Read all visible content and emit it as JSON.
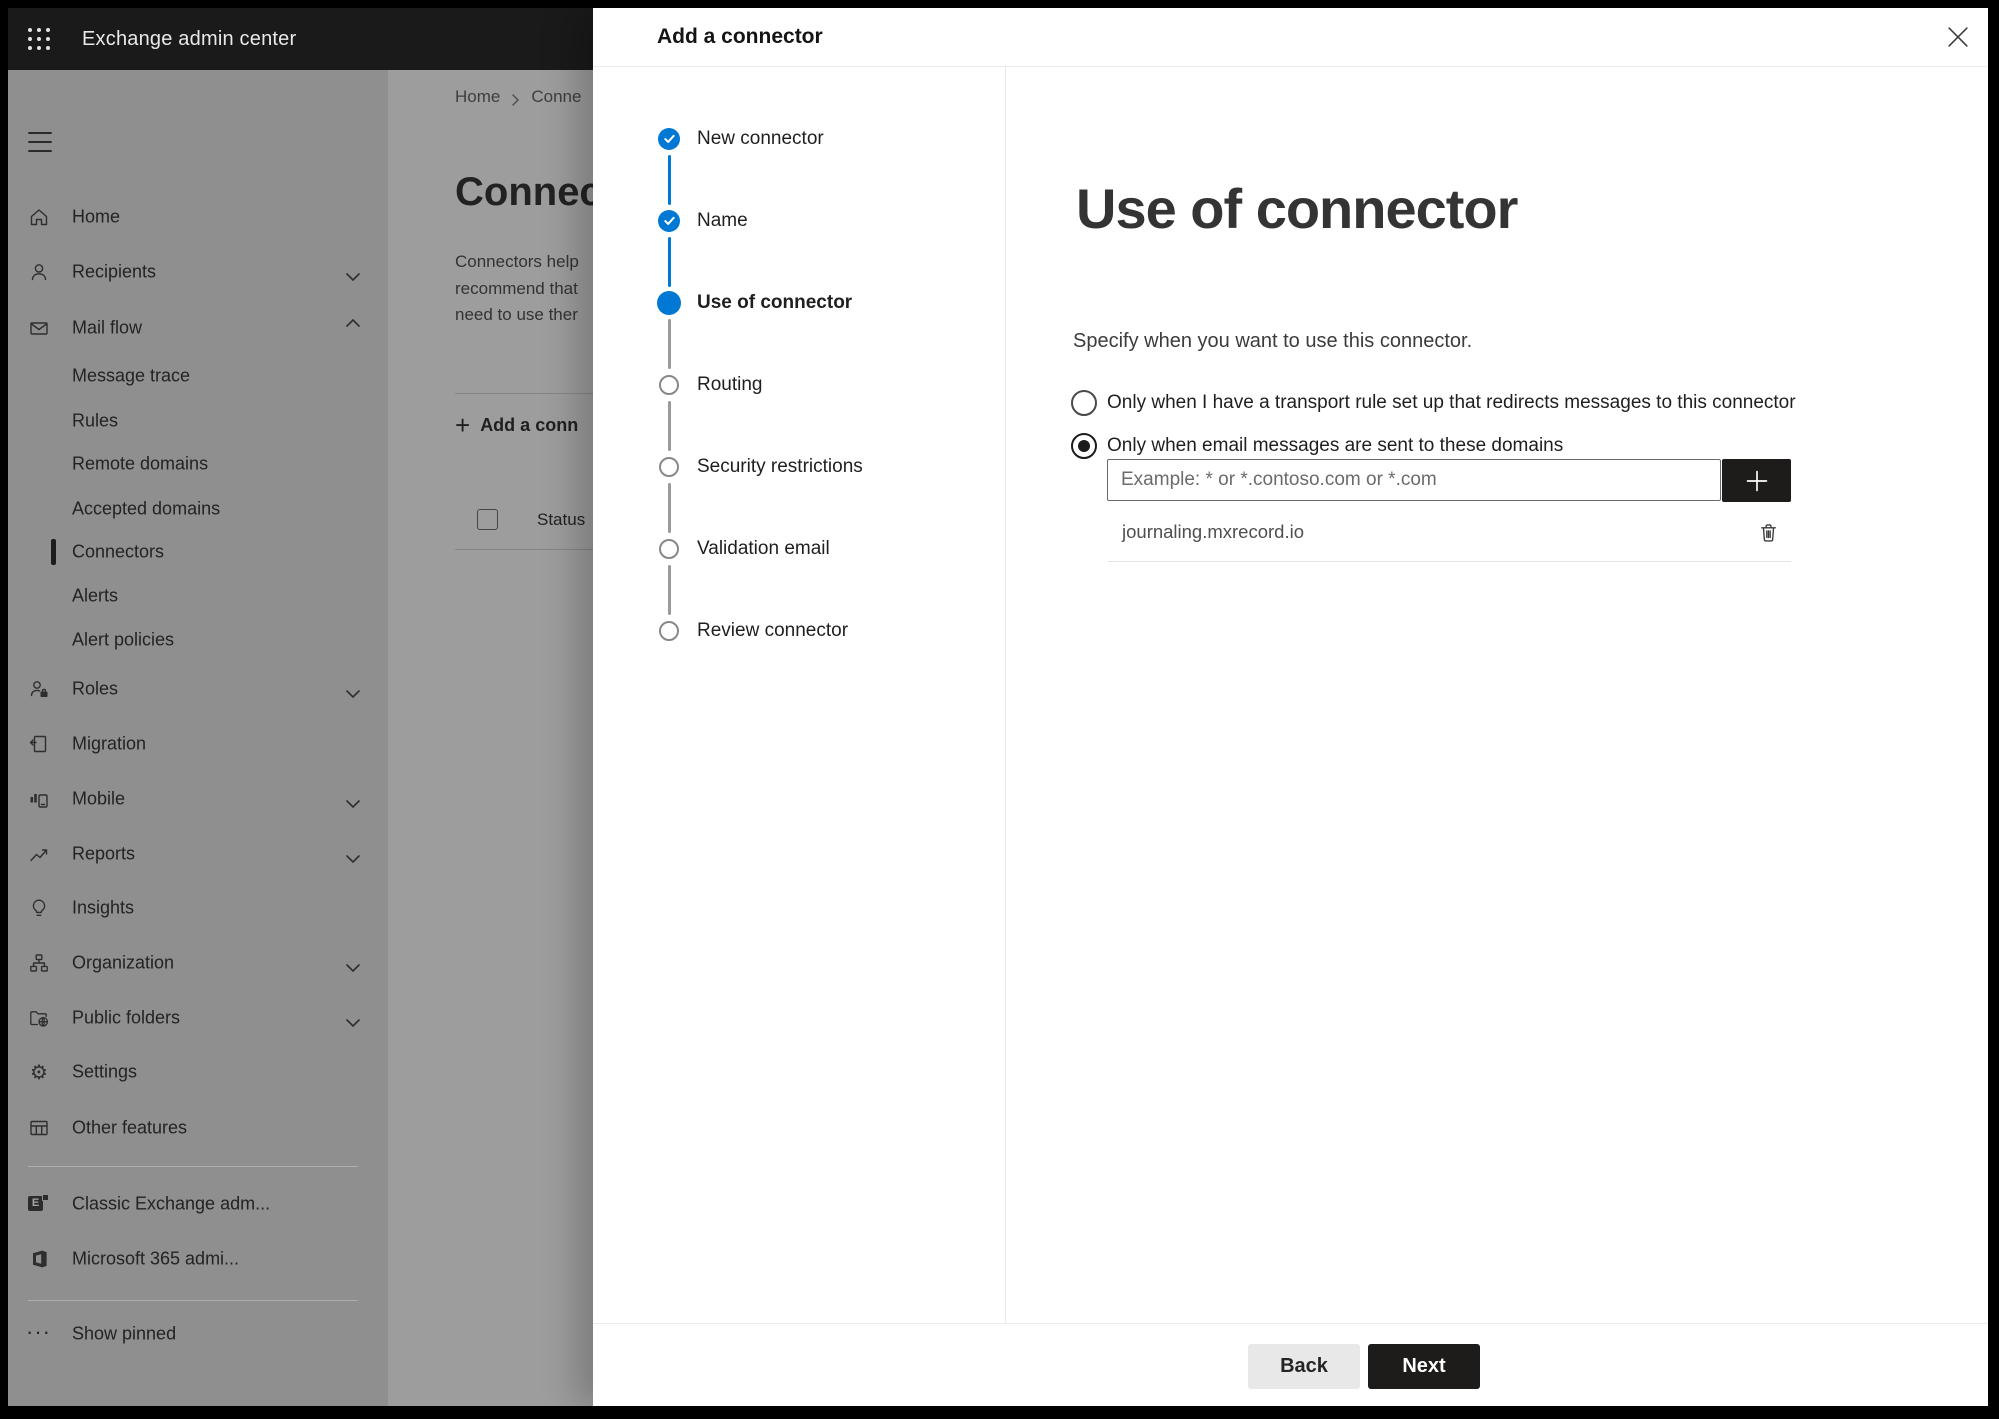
{
  "colors": {
    "accent": "#0078d4",
    "topbar_bg": "#1a1a1a",
    "sidebar_bg": "#8f8f8f",
    "content_bg": "#9d9d9d",
    "dark_button_bg": "#1d1c1b"
  },
  "topbar": {
    "title": "Exchange admin center"
  },
  "sidebar": {
    "items": [
      {
        "label": "Home"
      },
      {
        "label": "Recipients"
      },
      {
        "label": "Mail flow"
      },
      {
        "label": "Message trace"
      },
      {
        "label": "Rules"
      },
      {
        "label": "Remote domains"
      },
      {
        "label": "Accepted domains"
      },
      {
        "label": "Connectors"
      },
      {
        "label": "Alerts"
      },
      {
        "label": "Alert policies"
      },
      {
        "label": "Roles"
      },
      {
        "label": "Migration"
      },
      {
        "label": "Mobile"
      },
      {
        "label": "Reports"
      },
      {
        "label": "Insights"
      },
      {
        "label": "Organization"
      },
      {
        "label": "Public folders"
      },
      {
        "label": "Settings"
      },
      {
        "label": "Other features"
      },
      {
        "label": "Classic Exchange adm..."
      },
      {
        "label": "Microsoft 365 admi..."
      },
      {
        "label": "Show pinned"
      }
    ]
  },
  "page": {
    "breadcrumb": {
      "home": "Home",
      "current": "Conne"
    },
    "heading": "Connec",
    "description_lines": [
      "Connectors help",
      "recommend that",
      "need to use ther"
    ],
    "add_button": "Add a conn",
    "status_header": "Status"
  },
  "modal": {
    "title": "Add a connector",
    "steps": [
      {
        "label": "New connector",
        "state": "done"
      },
      {
        "label": "Name",
        "state": "done"
      },
      {
        "label": "Use of connector",
        "state": "current"
      },
      {
        "label": "Routing",
        "state": "todo"
      },
      {
        "label": "Security restrictions",
        "state": "todo"
      },
      {
        "label": "Validation email",
        "state": "todo"
      },
      {
        "label": "Review connector",
        "state": "todo"
      }
    ],
    "content": {
      "heading": "Use of connector",
      "instruction": "Specify when you want to use this connector.",
      "options": [
        {
          "label": "Only when I have a transport rule set up that redirects messages to this connector",
          "selected": false
        },
        {
          "label": "Only when email messages are sent to these domains",
          "selected": true
        }
      ],
      "domain_input_placeholder": "Example: * or *.contoso.com or *.com",
      "plus_label": "+",
      "domains": [
        "journaling.mxrecord.io"
      ]
    },
    "footer": {
      "back": "Back",
      "next": "Next"
    }
  }
}
